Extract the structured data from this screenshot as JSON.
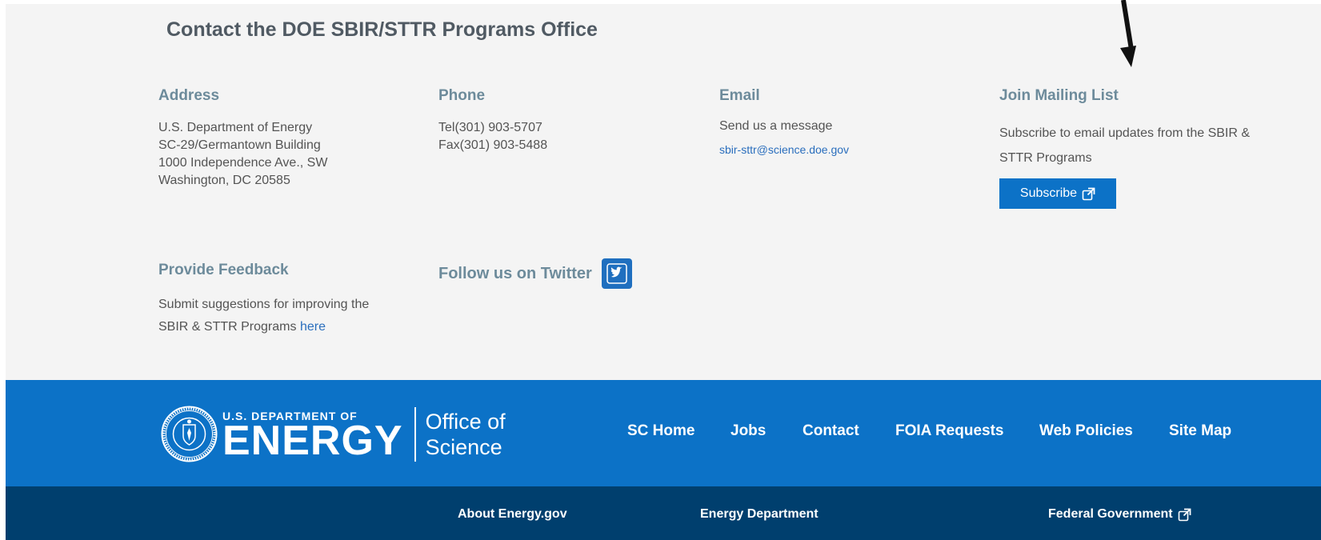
{
  "contact": {
    "title": "Contact the DOE SBIR/STTR Programs Office",
    "address": {
      "heading": "Address",
      "lines": [
        "U.S. Department of Energy",
        "SC-29/Germantown Building",
        "1000 Independence Ave., SW",
        "Washington, DC 20585"
      ]
    },
    "phone": {
      "heading": "Phone",
      "lines": [
        "Tel(301) 903-5707",
        "Fax(301) 903-5488"
      ]
    },
    "email": {
      "heading": "Email",
      "message": "Send us a message",
      "address": "sbir-sttr@science.doe.gov"
    },
    "mailing": {
      "heading": "Join Mailing List",
      "text": "Subscribe to email updates from the SBIR & STTR Programs",
      "button": "Subscribe",
      "button_icon": "external-link-icon"
    },
    "feedback": {
      "heading": "Provide Feedback",
      "text": "Submit suggestions for improving the SBIR & STTR Programs",
      "link": "here"
    },
    "twitter": {
      "label": "Follow us on Twitter",
      "icon": "twitter-icon"
    }
  },
  "footer": {
    "logo": {
      "small": "U.S. DEPARTMENT OF",
      "big": "ENERGY",
      "office_line1": "Office of",
      "office_line2": "Science"
    },
    "nav": [
      "SC Home",
      "Jobs",
      "Contact",
      "FOIA Requests",
      "Web Policies",
      "Site Map"
    ],
    "bottom_links": [
      "About Energy.gov",
      "Energy Department",
      "Federal Government"
    ]
  },
  "colors": {
    "accent": "#0c72c7",
    "dark_footer": "#003f6e",
    "heading": "#6d8b9b",
    "link": "#2a6ebd"
  }
}
